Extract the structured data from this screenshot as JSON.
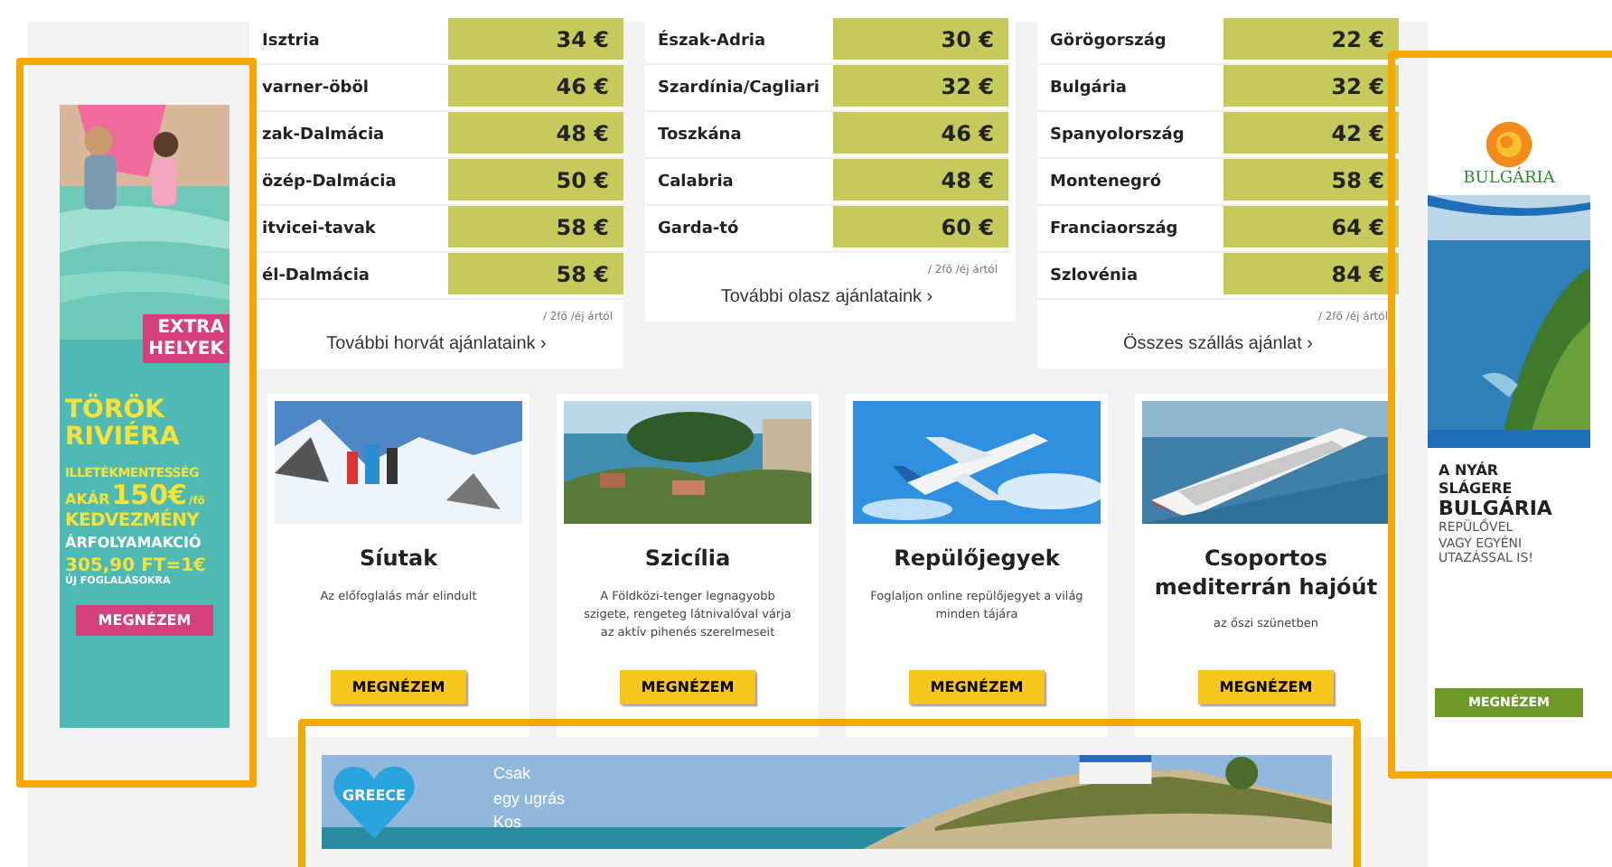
{
  "price_tables": [
    {
      "rows": [
        {
          "region": "Isztria",
          "price": "34 €"
        },
        {
          "region": "varner-öböl",
          "price": "46 €"
        },
        {
          "region": "zak-Dalmácia",
          "price": "48 €"
        },
        {
          "region": "özép-Dalmácia",
          "price": "50 €"
        },
        {
          "region": "itvicei-tavak",
          "price": "58 €"
        },
        {
          "region": "él-Dalmácia",
          "price": "58 €"
        }
      ],
      "note": "/ 2fő /éj ártól",
      "link": "További horvát ajánlataink ›"
    },
    {
      "rows": [
        {
          "region": "Észak-Adria",
          "price": "30 €"
        },
        {
          "region": "Szardínia/Cagliari",
          "price": "32 €"
        },
        {
          "region": "Toszkána",
          "price": "46 €"
        },
        {
          "region": "Calabria",
          "price": "48 €"
        },
        {
          "region": "Garda-tó",
          "price": "60 €"
        }
      ],
      "note": "/ 2fő /éj ártól",
      "link": "További olasz ajánlataink ›"
    },
    {
      "rows": [
        {
          "region": "Görögország",
          "price": "22 €"
        },
        {
          "region": "Bulgária",
          "price": "32 €"
        },
        {
          "region": "Spanyolország",
          "price": "42 €"
        },
        {
          "region": "Montenegró",
          "price": "58 €"
        },
        {
          "region": "Franciaország",
          "price": "64 €"
        },
        {
          "region": "Szlovénia",
          "price": "84 €"
        }
      ],
      "note": "/ 2fő /éj ártól",
      "link": "Összes szállás ajánlat ›"
    }
  ],
  "cards": [
    {
      "title": "Síutak",
      "text": "Az előfoglalás már elindult",
      "button": "MEGNÉZEM"
    },
    {
      "title": "Szicília",
      "text": "A Földközi-tenger legnagyobb szigete, rengeteg látnivalóval várja az aktív pihenés szerelmeseit",
      "button": "MEGNÉZEM"
    },
    {
      "title": "Repülőjegyek",
      "text": "Foglaljon online repülőjegyet a világ minden tájára",
      "button": "MEGNÉZEM"
    },
    {
      "title": "Csoportos mediterrán hajóút",
      "text": "az őszi szünetben",
      "button": "MEGNÉZEM"
    }
  ],
  "left_ad": {
    "highlighted": true,
    "tag": [
      "EXTRA",
      "HELYEK"
    ],
    "headline": [
      "TÖRÖK",
      "RIVIÉRA"
    ],
    "line_1": "ILLETÉKMENTESSÉG",
    "prefix": "AKÁR",
    "amount": "150€",
    "suffix": "/fő",
    "line_2": "KEDVEZMÉNY",
    "line_3": "ÁRFOLYAMAKCIÓ",
    "rate": "305,90 FT=1€",
    "line_4": "ÚJ FOGLALÁSOKRA",
    "button": "MEGNÉZEM"
  },
  "right_ad": {
    "highlighted": true,
    "logo": "BULGÁRIA",
    "lines": [
      "A NYÁR",
      "SLÁGERE"
    ],
    "headline": "BULGÁRIA",
    "body": [
      "REPÜLŐVEL",
      "VAGY EGYÉNI",
      "UTAZÁSSAL IS!"
    ],
    "button": "MEGNÉZEM"
  },
  "bottom_banner": {
    "highlighted": true,
    "badge": "GREECE",
    "lines": [
      "Csak",
      "egy ugrás",
      "Kos"
    ]
  }
}
